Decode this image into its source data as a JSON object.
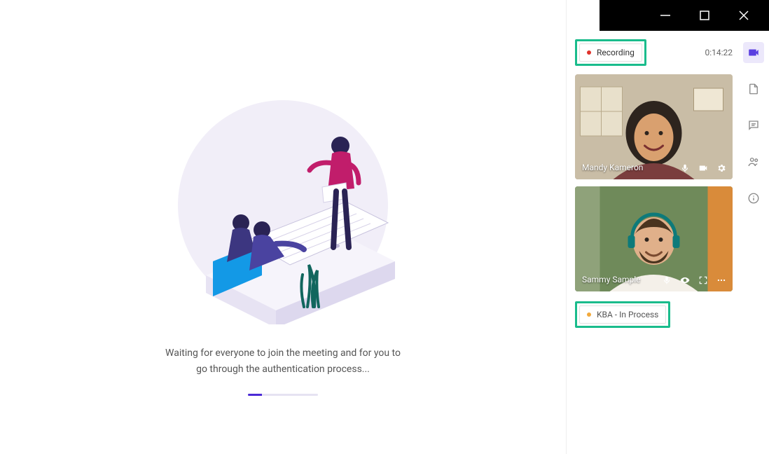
{
  "main": {
    "waiting_text": "Waiting for everyone to join the meeting and for you to go through the authentication process..."
  },
  "panel": {
    "recording_label": "Recording",
    "timer": "0:14:22",
    "tiles": [
      {
        "name": "Mandy Kameron"
      },
      {
        "name": "Sammy Sample"
      }
    ],
    "kba_label": "KBA - In Process"
  },
  "rail": {
    "items": [
      "video",
      "document",
      "chat",
      "participants",
      "info"
    ]
  }
}
